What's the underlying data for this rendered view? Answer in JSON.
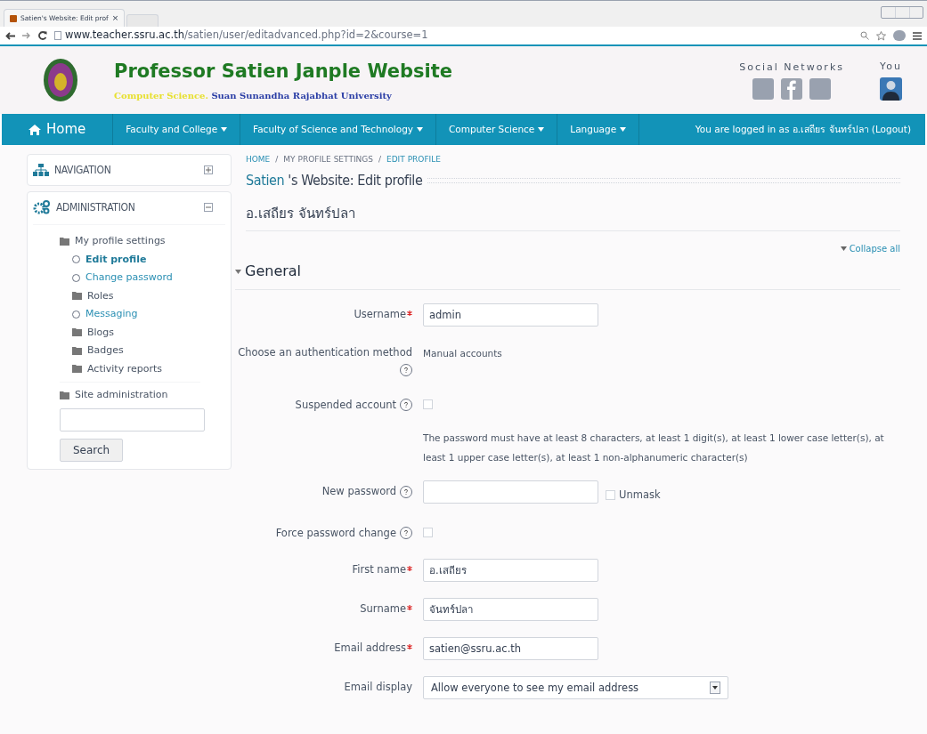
{
  "browser": {
    "tab_title": "Satien's Website: Edit prof",
    "tab_close": "×",
    "url_host": "www.teacher.ssru.ac.th",
    "url_path": "/satien/user/editadvanced.php?id=2&course=1"
  },
  "header": {
    "title": "Professor Satien Janple Website",
    "subtitle_part1": "Computer Science.",
    "subtitle_part2": "Suan Sunandha Rajabhat University",
    "social_label": "Social Networks",
    "you_label": "You"
  },
  "navbar": {
    "items": [
      {
        "label": "Home",
        "kind": "home"
      },
      {
        "label": "Faculty and College",
        "kind": "menu"
      },
      {
        "label": "Faculty of Science and Technology",
        "kind": "menu"
      },
      {
        "label": "Computer Science",
        "kind": "menu"
      },
      {
        "label": "Language",
        "kind": "menu"
      }
    ],
    "login_text": "You are logged in as อ.เสถียร จันทร์ปลา (Logout)"
  },
  "sidebar": {
    "blocks": [
      {
        "title": "NAVIGATION",
        "kind": "navigation",
        "expanded": false
      },
      {
        "title": "ADMINISTRATION",
        "kind": "administration",
        "expanded": true
      }
    ],
    "tree": [
      {
        "label": "My profile settings",
        "kind": "folder",
        "selected": false,
        "children": [
          {
            "label": "Edit profile",
            "kind": "page",
            "selected": true
          },
          {
            "label": "Change password",
            "kind": "page",
            "selected": false
          },
          {
            "label": "Roles",
            "kind": "folder",
            "selected": false
          },
          {
            "label": "Messaging",
            "kind": "page",
            "selected": false
          },
          {
            "label": "Blogs",
            "kind": "folder",
            "selected": false
          },
          {
            "label": "Badges",
            "kind": "folder",
            "selected": false
          },
          {
            "label": "Activity reports",
            "kind": "folder",
            "selected": false
          }
        ]
      },
      {
        "label": "Site administration",
        "kind": "folder",
        "selected": false
      }
    ],
    "search_button": "Search"
  },
  "breadcrumb": [
    "HOME",
    "MY PROFILE SETTINGS",
    "EDIT PROFILE"
  ],
  "breadcrumb_separator": "/",
  "page_title_part1": "Satien",
  "page_title_part2": "'s Website: Edit profile",
  "user_name": "อ.เสถียร จันทร์ปลา",
  "collapse_all": "Collapse all",
  "section": {
    "title": "General",
    "expanded": true
  },
  "fields": [
    {
      "kind": "text",
      "label": "Username",
      "required": true,
      "help": false,
      "value": "admin"
    },
    {
      "kind": "static",
      "label": "Choose an authentication method",
      "required": false,
      "help": true,
      "value": "Manual accounts"
    },
    {
      "kind": "checkbox",
      "label": "Suspended account",
      "required": false,
      "help": true,
      "checked": false
    },
    {
      "kind": "note",
      "text": "The password must have at least 8 characters, at least 1 digit(s), at least 1 lower case letter(s), at least 1 upper case letter(s), at least 1 non-alphanumeric character(s)"
    },
    {
      "kind": "password",
      "label": "New password",
      "required": false,
      "help": true,
      "unmask_label": "Unmask",
      "unmask_checked": false
    },
    {
      "kind": "checkbox",
      "label": "Force password change",
      "required": false,
      "help": true,
      "checked": false
    },
    {
      "kind": "text",
      "label": "First name",
      "required": true,
      "help": false,
      "value": "อ.เสถียร"
    },
    {
      "kind": "text",
      "label": "Surname",
      "required": true,
      "help": false,
      "value": "จันทร์ปลา"
    },
    {
      "kind": "text",
      "label": "Email address",
      "required": true,
      "help": false,
      "value": "satien@ssru.ac.th"
    },
    {
      "kind": "select",
      "label": "Email display",
      "required": false,
      "help": false,
      "value": "Allow everyone to see my email address"
    }
  ]
}
